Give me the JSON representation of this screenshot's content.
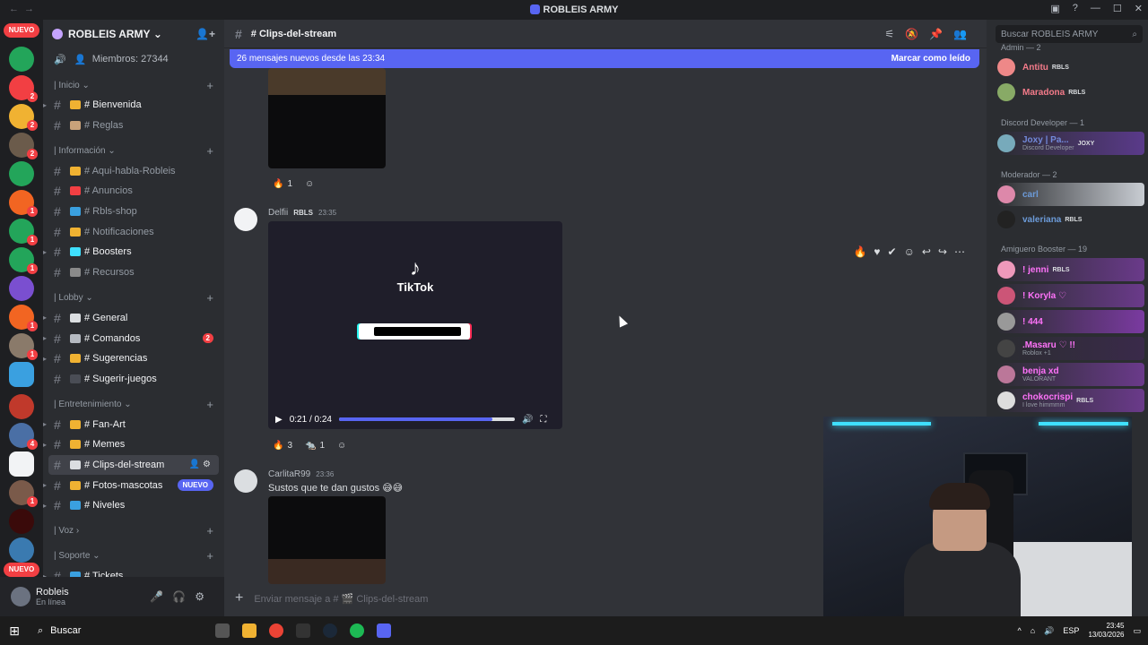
{
  "window": {
    "title": "ROBLEIS ARMY"
  },
  "guild_badges": [
    "NUEVO",
    "2",
    "2",
    "2",
    "1",
    "1",
    "1",
    "1",
    "1",
    "1",
    "1",
    "1",
    "4",
    "1",
    "1",
    "1",
    "NUEVO"
  ],
  "server": {
    "name": "ROBLEIS ARMY",
    "members_label": "Miembros: 27344",
    "categories": [
      {
        "name": "| Inicio",
        "channels": [
          {
            "label": "# Bienvenida",
            "unread": true
          },
          {
            "label": "# Reglas",
            "unread": false
          }
        ]
      },
      {
        "name": "| Información",
        "channels": [
          {
            "label": "# Aqui-habla-Robleis",
            "unread": false
          },
          {
            "label": "# Anuncios",
            "unread": false
          },
          {
            "label": "# Rbls-shop",
            "unread": false
          },
          {
            "label": "# Notificaciones",
            "unread": false
          },
          {
            "label": "# Boosters",
            "unread": true
          },
          {
            "label": "# Recursos",
            "unread": false
          }
        ]
      },
      {
        "name": "| Lobby",
        "channels": [
          {
            "label": "# General",
            "unread": true
          },
          {
            "label": "# Comandos",
            "unread": true,
            "badge": "2"
          },
          {
            "label": "# Sugerencias",
            "unread": true
          },
          {
            "label": "# Sugerir-juegos",
            "unread": true
          }
        ]
      },
      {
        "name": "| Entretenimiento",
        "channels": [
          {
            "label": "# Fan-Art",
            "unread": true
          },
          {
            "label": "# Memes",
            "unread": true
          },
          {
            "label": "# Clips-del-stream",
            "unread": true,
            "active": true
          },
          {
            "label": "# Fotos-mascotas",
            "unread": true,
            "nuevo": "NUEVO"
          },
          {
            "label": "# Niveles",
            "unread": true
          }
        ]
      },
      {
        "name": "| Voz",
        "channels": []
      },
      {
        "name": "| Soporte",
        "channels": [
          {
            "label": "# Tickets",
            "unread": true
          }
        ]
      }
    ]
  },
  "user": {
    "name": "Robleis",
    "status": "En línea"
  },
  "channel": {
    "name": "# Clips-del-stream"
  },
  "new_messages": {
    "text": "26 mensajes nuevos desde las 23:34",
    "action": "Marcar como leído"
  },
  "messages": [
    {
      "reactions": [
        {
          "emoji": "🔥",
          "count": "1"
        }
      ]
    },
    {
      "author": "Delfii",
      "tag": "RBLS",
      "time": "23:35",
      "video": {
        "brand": "TikTok",
        "time": "0:21 / 0:24",
        "progress": 0.875
      },
      "reactions": [
        {
          "emoji": "🔥",
          "count": "3"
        },
        {
          "emoji": "🐀",
          "count": "1"
        }
      ]
    },
    {
      "author": "CarlitaR99",
      "time": "23:36",
      "text": "Sustos que te dan gustos 😅😅"
    }
  ],
  "composer": {
    "placeholder": "Enviar mensaje a # 🎬 Clips-del-stream"
  },
  "search": {
    "placeholder": "Buscar ROBLEIS ARMY"
  },
  "member_list": {
    "roles": [
      {
        "name": "Admin — 2",
        "members": [
          {
            "name": "Antitu",
            "tag": "RBLS",
            "color": "#f47b8a"
          },
          {
            "name": "Maradona",
            "tag": "RBLS",
            "color": "#f47b8a"
          }
        ]
      },
      {
        "name": "Discord Developer — 1",
        "members": [
          {
            "name": "Joxy | Pa...",
            "tag": "JOXY",
            "sub": "Discord Developer",
            "color": "#7289da"
          }
        ]
      },
      {
        "name": "Moderador — 2",
        "members": [
          {
            "name": "carl",
            "color": "#6c9bd9"
          },
          {
            "name": "valeriana",
            "tag": "RBLS",
            "color": "#6c9bd9"
          }
        ]
      },
      {
        "name": "Amiguero Booster — 19",
        "members": [
          {
            "name": "! jenni",
            "tag": "RBLS",
            "color": "#ff73fa"
          },
          {
            "name": "! Koryla ♡",
            "color": "#ff73fa"
          },
          {
            "name": "! 444",
            "color": "#ff73fa"
          },
          {
            "name": ".Masaru ♡ !!",
            "sub": "Roblox +1",
            "color": "#ff73fa"
          },
          {
            "name": "benja xd",
            "sub": "VALORANT",
            "color": "#ff73fa"
          },
          {
            "name": "chokocrispi",
            "tag": "RBLS",
            "sub": "I love himmmm",
            "color": "#ff73fa"
          }
        ]
      }
    ]
  },
  "taskbar": {
    "search": "Buscar",
    "lang": "ESP",
    "time": "23:45",
    "date": "13/03/2026"
  },
  "colors": {
    "blurple": "#5865f2",
    "red": "#f23f43",
    "green": "#23a55a"
  }
}
